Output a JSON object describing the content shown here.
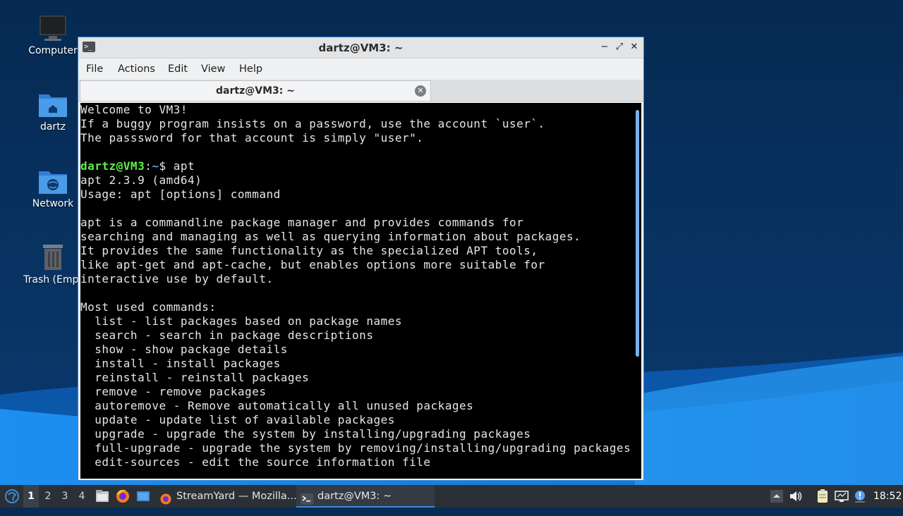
{
  "desktop": {
    "icons": [
      {
        "label": "Computer",
        "icon": "computer-icon"
      },
      {
        "label": "dartz",
        "icon": "home-folder-icon"
      },
      {
        "label": "Network",
        "icon": "network-folder-icon"
      },
      {
        "label": "Trash (Empt",
        "icon": "trash-icon"
      }
    ]
  },
  "window": {
    "title": "dartz@VM3: ~",
    "buttons": {
      "minimize": "−",
      "maximize": "⤢",
      "close": "✕"
    },
    "menu": [
      "File",
      "Actions",
      "Edit",
      "View",
      "Help"
    ],
    "tab": {
      "label": "dartz@VM3: ~",
      "close": "✕"
    }
  },
  "terminal": {
    "colors": {
      "user": "#5cf04a",
      "path": "#5ba0ff",
      "text": "#e6e6e6",
      "background": "#000000"
    },
    "lines": [
      "Welcome to VM3!",
      "If a buggy program insists on a password, use the account `user`.",
      "The passsword for that account is simply \"user\".",
      "",
      "",
      "apt 2.3.9 (amd64)",
      "Usage: apt [options] command",
      "",
      "apt is a commandline package manager and provides commands for",
      "searching and managing as well as querying information about packages.",
      "It provides the same functionality as the specialized APT tools,",
      "like apt-get and apt-cache, but enables options more suitable for",
      "interactive use by default.",
      "",
      "Most used commands:",
      "  list - list packages based on package names",
      "  search - search in package descriptions",
      "  show - show package details",
      "  install - install packages",
      "  reinstall - reinstall packages",
      "  remove - remove packages",
      "  autoremove - Remove automatically all unused packages",
      "  update - update list of available packages",
      "  upgrade - upgrade the system by installing/upgrading packages",
      "  full-upgrade - upgrade the system by removing/installing/upgrading packages",
      "  edit-sources - edit the source information file"
    ],
    "prompt": {
      "user": "dartz@VM3",
      "sep": ":",
      "path": "~",
      "symbol": "$ ",
      "command": "apt"
    }
  },
  "taskbar": {
    "start_icon": "lubuntu-start-icon",
    "workspaces": [
      "1",
      "2",
      "3",
      "4"
    ],
    "active_workspace": "1",
    "quicklaunch": [
      "file-manager-icon",
      "firefox-icon",
      "show-desktop-icon"
    ],
    "tasks": [
      {
        "label": "StreamYard — Mozilla...",
        "icon": "firefox-icon",
        "active": false
      },
      {
        "label": "dartz@VM3: ~",
        "icon": "terminal-icon",
        "active": true
      }
    ],
    "tray": [
      "tray-up-arrow-icon",
      "volume-icon",
      "clipboard-icon",
      "network-icon",
      "notification-icon"
    ],
    "clock": "18:52"
  }
}
